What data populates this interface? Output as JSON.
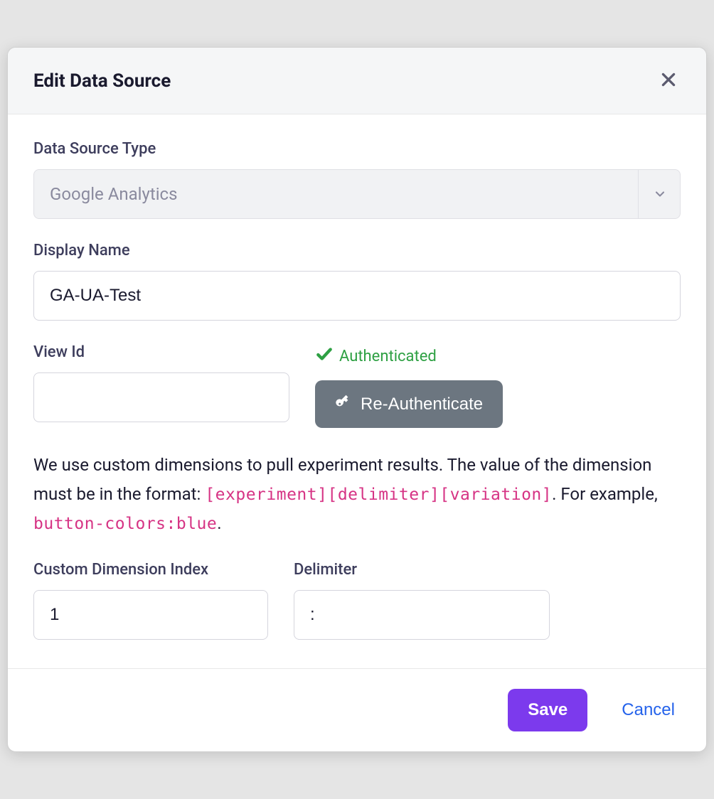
{
  "modal": {
    "title": "Edit Data Source"
  },
  "form": {
    "data_source_type": {
      "label": "Data Source Type",
      "value": "Google Analytics"
    },
    "display_name": {
      "label": "Display Name",
      "value": "GA-UA-Test"
    },
    "view_id": {
      "label": "View Id",
      "value": ""
    },
    "auth": {
      "status": "Authenticated",
      "button_label": "Re-Authenticate"
    },
    "help_text": {
      "part1": "We use custom dimensions to pull experiment results. The value of the dimension must be in the format: ",
      "code1": "[experiment][delimiter][variation]",
      "part2": ". For example, ",
      "code2": "button-colors:blue",
      "part3": "."
    },
    "custom_dimension_index": {
      "label": "Custom Dimension Index",
      "value": "1"
    },
    "delimiter": {
      "label": "Delimiter",
      "value": ":"
    }
  },
  "footer": {
    "save_label": "Save",
    "cancel_label": "Cancel"
  }
}
